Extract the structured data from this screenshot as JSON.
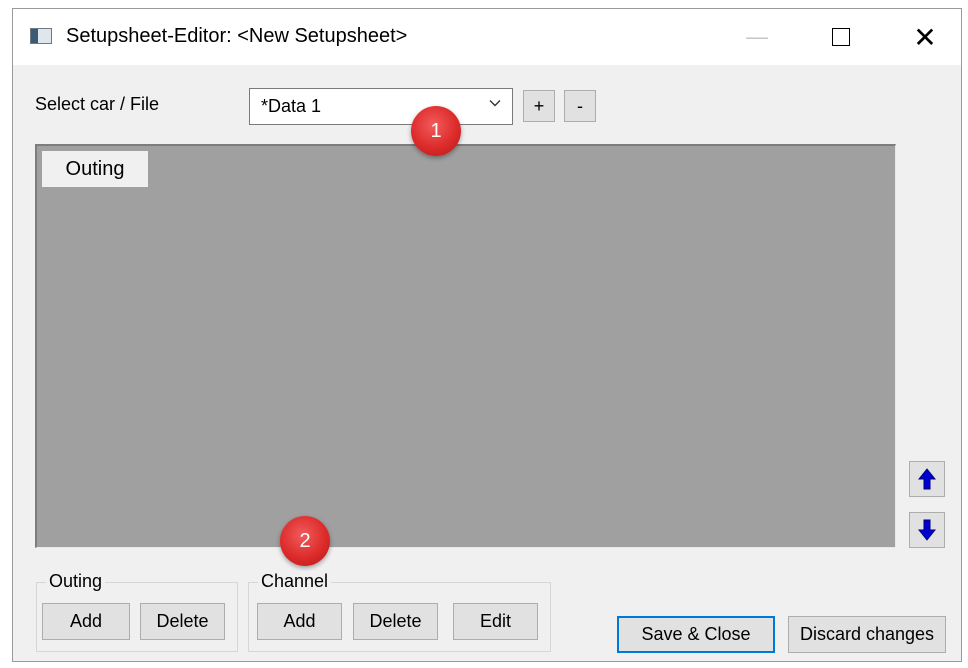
{
  "window": {
    "title": "Setupsheet-Editor: <New Setupsheet>",
    "controls": {
      "minimize": "—",
      "close": "✕"
    }
  },
  "selector": {
    "label": "Select car / File",
    "selected": "*Data 1",
    "add_label": "+",
    "remove_label": "-"
  },
  "tabs": [
    {
      "label": "Outing"
    }
  ],
  "badges": {
    "first": "1",
    "second": "2"
  },
  "outing_group": {
    "title": "Outing",
    "add_label": "Add",
    "delete_label": "Delete"
  },
  "channel_group": {
    "title": "Channel",
    "add_label": "Add",
    "delete_label": "Delete",
    "edit_label": "Edit"
  },
  "footer": {
    "save_label": "Save & Close",
    "discard_label": "Discard changes"
  },
  "colors": {
    "accent": "#0078d7",
    "arrow": "#0000d0",
    "badge": "#dd2b2b",
    "panel": "#a0a0a0"
  },
  "icons": {
    "move_up": "arrow-up-icon",
    "move_down": "arrow-down-icon",
    "dropdown": "chevron-down-icon"
  }
}
